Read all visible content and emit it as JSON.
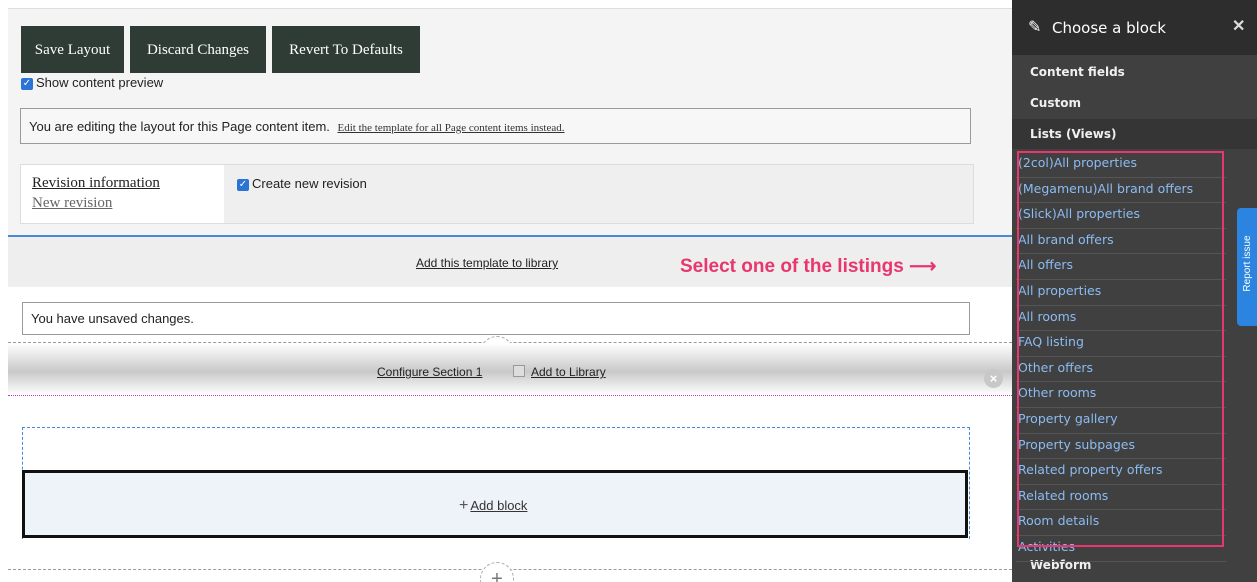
{
  "toolbar": {
    "save_label": "Save Layout",
    "discard_label": "Discard Changes",
    "revert_label": "Revert To Defaults",
    "show_preview_label": "Show content preview"
  },
  "notice": {
    "text": "You are editing the layout for this Page content item.",
    "link": "Edit the template for all Page content items instead."
  },
  "revision": {
    "title": "Revision information",
    "subtitle": "New revision",
    "checkbox_label": "Create new revision"
  },
  "template_link": "Add this template to library",
  "callout": "Select one of the listings",
  "unsaved_text": "You have unsaved changes.",
  "section": {
    "configure_label": "Configure Section 1",
    "library_label": "Add to Library"
  },
  "add_block_label": "Add block",
  "sidebar": {
    "title": "Choose a block",
    "sections": [
      "Content fields",
      "Custom",
      "Lists (Views)",
      "Webform"
    ],
    "items": [
      "(2col)All properties",
      "(Megamenu)All brand offers",
      "(Slick)All properties",
      "All brand offers",
      "All offers",
      "All properties",
      "All rooms",
      "FAQ listing",
      "Other offers",
      "Other rooms",
      "Property gallery",
      "Property subpages",
      "Related property offers",
      "Related rooms",
      "Room details",
      "Activities"
    ]
  },
  "report_issue_label": "Report issue",
  "colors": {
    "button_bg": "#2f3b35",
    "callout": "#e8366e",
    "sidebar_bg": "#404040",
    "sidebar_link": "#8bbcf2",
    "report_bg": "#2b84e0"
  }
}
